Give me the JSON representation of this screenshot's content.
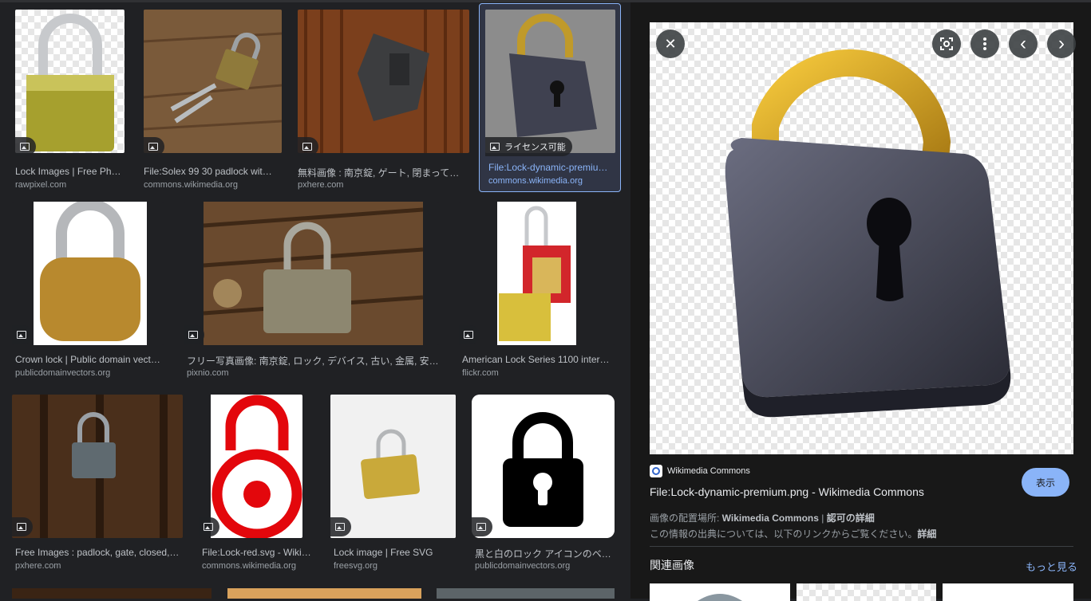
{
  "results": [
    {
      "caption": "Lock Images | Free Pho…",
      "source": "rawpixel.com",
      "badge": ""
    },
    {
      "caption": "File:Solex 99 30 padlock wit…",
      "source": "commons.wikimedia.org",
      "badge": ""
    },
    {
      "caption": "無料画像 : 南京錠, ゲート, 閉まって…",
      "source": "pxhere.com",
      "badge": ""
    },
    {
      "caption": "File:Lock-dynamic-premiu…",
      "source": "commons.wikimedia.org",
      "badge": "ライセンス可能"
    },
    {
      "caption": "Crown lock | Public domain vect…",
      "source": "publicdomainvectors.org",
      "badge": ""
    },
    {
      "caption": "フリー写真画像: 南京錠, ロック, デバイス, 古い, 金属, 安…",
      "source": "pixnio.com",
      "badge": ""
    },
    {
      "caption": "American Lock Series 1100 inter…",
      "source": "flickr.com",
      "badge": ""
    },
    {
      "caption": "Free Images : padlock, gate, closed,…",
      "source": "pxhere.com",
      "badge": ""
    },
    {
      "caption": "File:Lock-red.svg - Wiki…",
      "source": "commons.wikimedia.org",
      "badge": ""
    },
    {
      "caption": "Lock image | Free SVG",
      "source": "freesvg.org",
      "badge": ""
    },
    {
      "caption": "黒と白のロック アイコンのベ…",
      "source": "publicdomainvectors.org",
      "badge": ""
    }
  ],
  "panel": {
    "controls": {
      "close": "✕",
      "prev": "‹",
      "next": "›"
    },
    "source_name": "Wikimedia Commons",
    "title": "File:Lock-dynamic-premium.png - Wikimedia Commons",
    "visit_label": "表示",
    "location_prefix": "画像の配置場所: ",
    "location_site": "Wikimedia Commons",
    "location_sep": " | ",
    "license_link": "認可の詳細",
    "info_text": "この情報の出典については、以下のリンクからご覧ください。",
    "info_link": "詳細",
    "related_heading": "関連画像",
    "more_label": "もっと見る"
  },
  "colors": {
    "accent": "#8ab4f8",
    "background": "#202124",
    "panel": "#181818"
  }
}
